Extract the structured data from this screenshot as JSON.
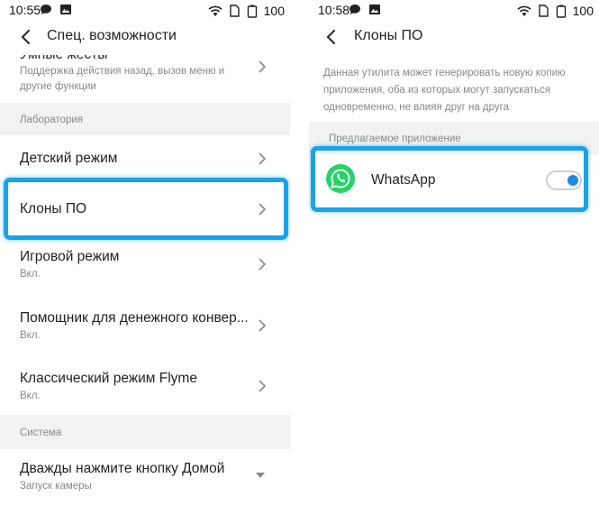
{
  "left": {
    "status": {
      "time": "10:55",
      "battery": "100"
    },
    "title": "Спец. возможности",
    "top_item": {
      "title": "Умные жесты",
      "subtitle": "Поддержка действия назад, вызов меню и другие функции"
    },
    "sections": [
      {
        "label": "Лаборатория"
      },
      {
        "label": "Система"
      }
    ],
    "items": [
      {
        "title": "Детский режим",
        "subtitle": ""
      },
      {
        "title": "Клоны ПО",
        "subtitle": ""
      },
      {
        "title": "Игровой режим",
        "subtitle": "Вкл."
      },
      {
        "title": "Помощник для денежного конвер...",
        "subtitle": "Вкл."
      },
      {
        "title": "Классический режим Flyme",
        "subtitle": "Вкл."
      }
    ],
    "system_item": {
      "title": "Дважды нажмите кнопку Домой",
      "subtitle": "Запуск камеры"
    }
  },
  "right": {
    "status": {
      "time": "10:58",
      "battery": "100"
    },
    "title": "Клоны ПО",
    "description": "Данная утилита может генерировать новую копию приложения, оба из которых могут запускаться одновременно, не влияя друг на друга",
    "section_label": "Предлагаемое приложение",
    "app": {
      "name": "WhatsApp",
      "toggle_on": true
    }
  },
  "colors": {
    "highlight": "#1aa3e6",
    "whatsapp": "#25d366",
    "toggle": "#1e88e5"
  }
}
